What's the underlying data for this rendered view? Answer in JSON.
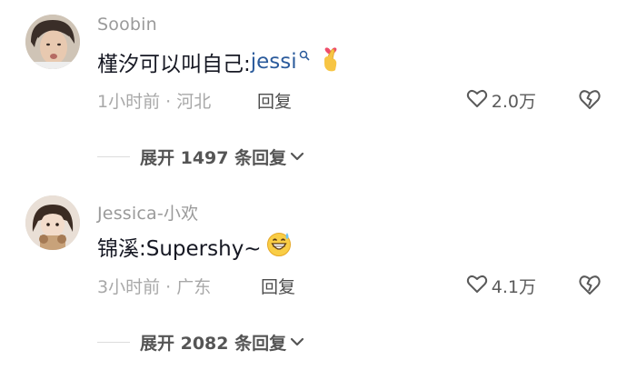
{
  "comments": [
    {
      "username": "Soobin",
      "text_main": "槿汐可以叫自己:",
      "link": "jessi",
      "time": "1小时前",
      "location": "河北",
      "reply_label": "回复",
      "likes": "2.0万",
      "expand_text": "展开 1497 条回复"
    },
    {
      "username": "Jessica-小欢",
      "text_main": "锦溪:Supershy~",
      "time": "3小时前",
      "location": "广东",
      "reply_label": "回复",
      "likes": "4.1万",
      "expand_text": "展开 2082 条回复"
    }
  ],
  "colors": {
    "link": "#2b5b9c",
    "meta": "#a8a8a8",
    "text": "#161823"
  },
  "icons": [
    "search-icon",
    "heart-hand-emoji",
    "heart-outline-icon",
    "broken-heart-icon",
    "chevron-down-icon",
    "grin-sweat-emoji"
  ]
}
